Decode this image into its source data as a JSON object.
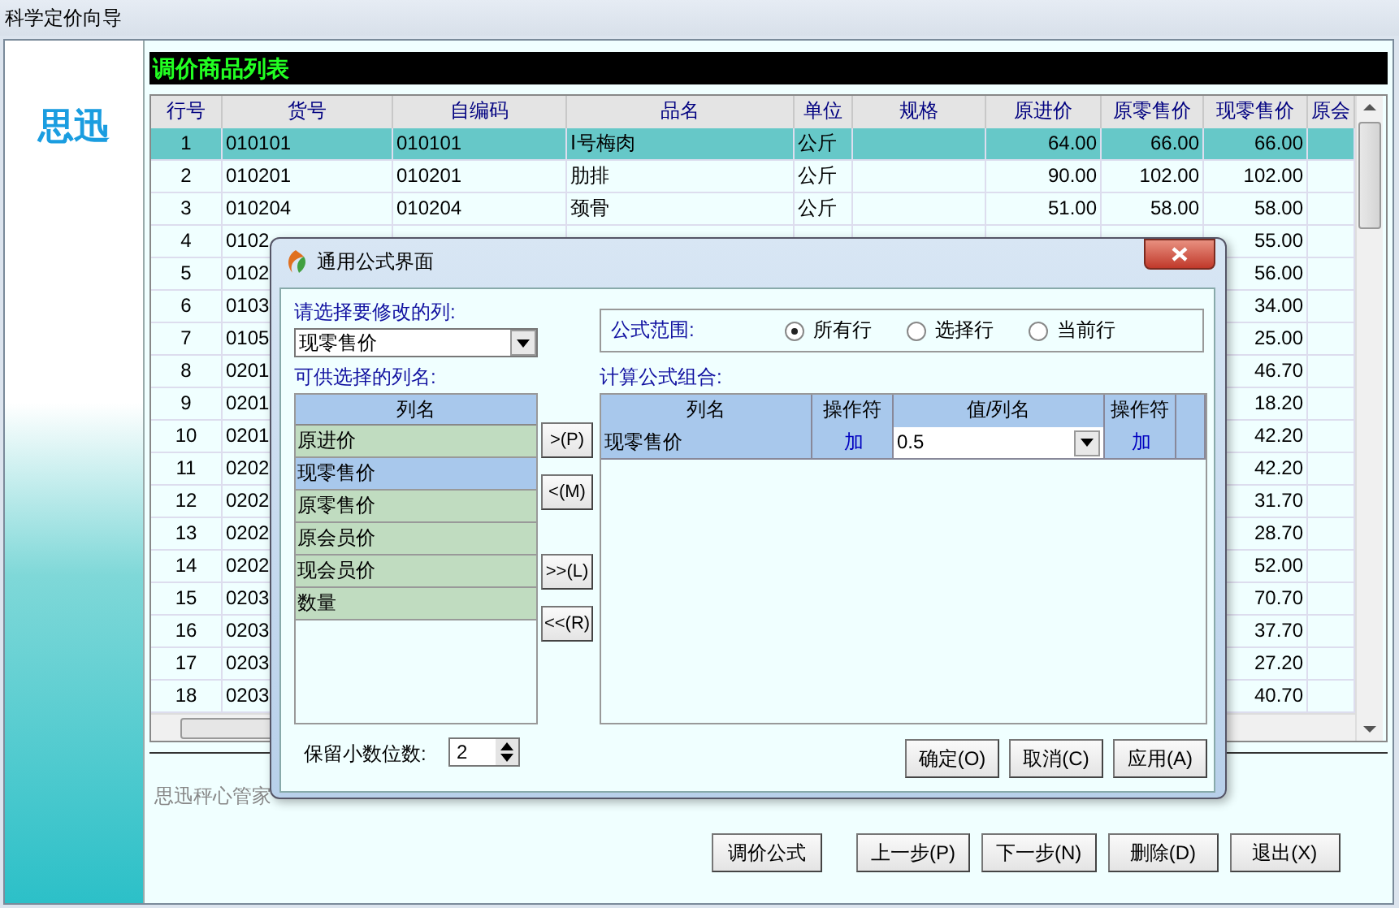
{
  "window": {
    "title": "科学定价向导"
  },
  "logo": "思迅",
  "list_title": "调价商品列表",
  "table": {
    "columns": [
      "行号",
      "货号",
      "自编码",
      "品名",
      "单位",
      "规格",
      "原进价",
      "原零售价",
      "现零售价",
      "原会"
    ],
    "rows": [
      {
        "selected": true,
        "no": "1",
        "code": "010101",
        "own_code": "010101",
        "name": "Ⅰ号梅肉",
        "unit": "公斤",
        "cost": "64.00",
        "old_retail": "66.00",
        "new_retail": "66.00"
      },
      {
        "selected": false,
        "no": "2",
        "code": "010201",
        "own_code": "010201",
        "name": "肋排",
        "unit": "公斤",
        "cost": "90.00",
        "old_retail": "102.00",
        "new_retail": "102.00"
      },
      {
        "selected": false,
        "no": "3",
        "code": "010204",
        "own_code": "010204",
        "name": "颈骨",
        "unit": "公斤",
        "cost": "51.00",
        "old_retail": "58.00",
        "new_retail": "58.00"
      },
      {
        "selected": false,
        "no": "4",
        "code": "0102",
        "new_retail": "55.00"
      },
      {
        "selected": false,
        "no": "5",
        "code": "0102",
        "new_retail": "56.00"
      },
      {
        "selected": false,
        "no": "6",
        "code": "0103",
        "new_retail": "34.00"
      },
      {
        "selected": false,
        "no": "7",
        "code": "0105",
        "new_retail": "25.00"
      },
      {
        "selected": false,
        "no": "8",
        "code": "0201",
        "new_retail": "46.70"
      },
      {
        "selected": false,
        "no": "9",
        "code": "0201",
        "new_retail": "18.20"
      },
      {
        "selected": false,
        "no": "10",
        "code": "0201",
        "new_retail": "42.20"
      },
      {
        "selected": false,
        "no": "11",
        "code": "0202",
        "new_retail": "42.20"
      },
      {
        "selected": false,
        "no": "12",
        "code": "0202",
        "new_retail": "31.70"
      },
      {
        "selected": false,
        "no": "13",
        "code": "0202",
        "new_retail": "28.70"
      },
      {
        "selected": false,
        "no": "14",
        "code": "0202",
        "new_retail": "52.00"
      },
      {
        "selected": false,
        "no": "15",
        "code": "0203",
        "new_retail": "70.70"
      },
      {
        "selected": false,
        "no": "16",
        "code": "0203",
        "new_retail": "37.70"
      },
      {
        "selected": false,
        "no": "17",
        "code": "0203",
        "new_retail": "27.20"
      },
      {
        "selected": false,
        "no": "18",
        "code": "0203",
        "new_retail": "40.70"
      }
    ]
  },
  "status_text": "思迅秤心管家",
  "buttons": [
    "调价公式",
    "上一步(P)",
    "下一步(N)",
    "删除(D)",
    "退出(X)"
  ],
  "dialog": {
    "title": "通用公式界面",
    "target_label": "请选择要修改的列:",
    "target_value": "现零售价",
    "available_label": "可供选择的列名:",
    "available_header": "列名",
    "available": [
      {
        "label": "原进价",
        "selected": false
      },
      {
        "label": "现零售价",
        "selected": true
      },
      {
        "label": "原零售价",
        "selected": false
      },
      {
        "label": "原会员价",
        "selected": false
      },
      {
        "label": "现会员价",
        "selected": false
      },
      {
        "label": "数量",
        "selected": false
      }
    ],
    "move_buttons": [
      ">(P)",
      "<(M)",
      ">>(L)",
      "<<(R)"
    ],
    "scope_label": "公式范围:",
    "scope": [
      {
        "label": "所有行",
        "selected": true
      },
      {
        "label": "选择行",
        "selected": false
      },
      {
        "label": "当前行",
        "selected": false
      }
    ],
    "formula_label": "计算公式组合:",
    "formula_columns": [
      "列名",
      "操作符",
      "值/列名",
      "操作符"
    ],
    "formula_rows": [
      {
        "column": "现零售价",
        "op": "加",
        "value": "0.5",
        "op2": "加"
      }
    ],
    "decimals_label": "保留小数位数:",
    "decimals": "2",
    "buttons": [
      "确定(O)",
      "取消(C)",
      "应用(A)"
    ]
  }
}
